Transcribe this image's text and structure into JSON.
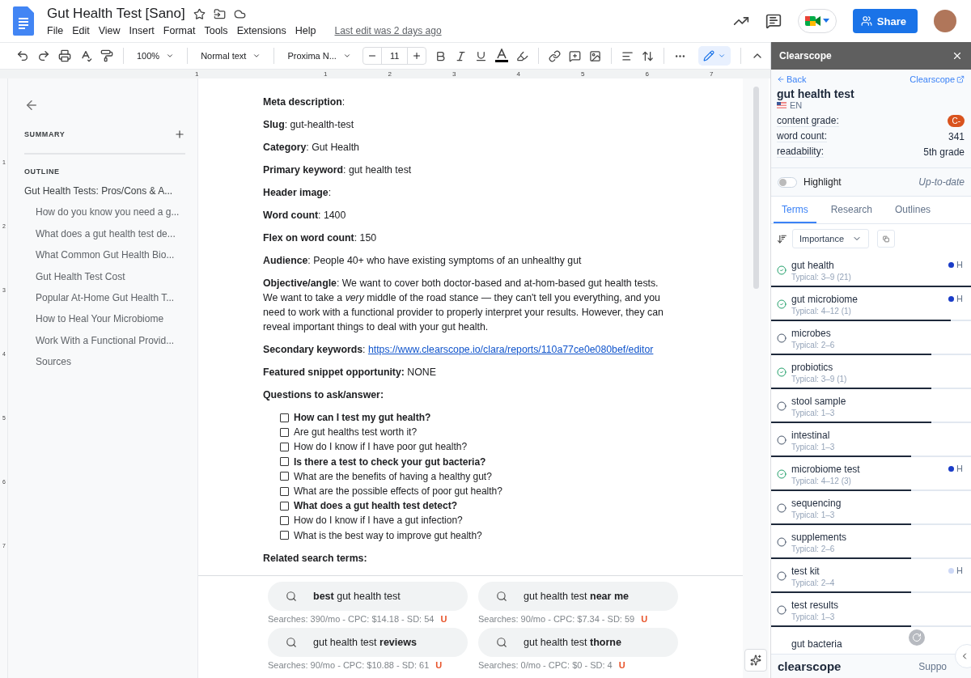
{
  "doc": {
    "title": "Gut Health Test [Sano]",
    "menu": [
      "File",
      "Edit",
      "View",
      "Insert",
      "Format",
      "Tools",
      "Extensions",
      "Help"
    ],
    "last_edit": "Last edit was 2 days ago"
  },
  "share": {
    "label": "Share"
  },
  "toolbar": {
    "zoom": "100%",
    "style": "Normal text",
    "font": "Proxima N...",
    "font_size": "11"
  },
  "ruler": [
    "1",
    "1",
    "2",
    "3",
    "4",
    "5",
    "6",
    "7"
  ],
  "vruler": [
    "1",
    "2",
    "3",
    "4",
    "5",
    "6",
    "7"
  ],
  "outline": {
    "summary_label": "SUMMARY",
    "outline_label": "OUTLINE",
    "items": [
      {
        "text": "Gut Health Tests: Pros/Cons & A...",
        "children": [
          {
            "text": "How do you know you need a g..."
          },
          {
            "text": "What does a gut health test de..."
          },
          {
            "text": "What Common Gut Health Bio..."
          },
          {
            "text": "Gut Health Test Cost"
          },
          {
            "text": "Popular At-Home Gut Health T..."
          },
          {
            "text": "How to Heal Your Microbiome"
          },
          {
            "text": "Work With a Functional Provid..."
          },
          {
            "text": "Sources"
          }
        ]
      }
    ]
  },
  "body": [
    {
      "kind": "para",
      "text": "**Meta description**:"
    },
    {
      "kind": "para",
      "text": "**Slug**: gut-health-test"
    },
    {
      "kind": "para",
      "text": "**Category**: Gut Health"
    },
    {
      "kind": "para",
      "text": "**Primary keyword**: gut health test"
    },
    {
      "kind": "para",
      "text": "**Header image**:"
    },
    {
      "kind": "para",
      "text": "**Word count**: 1400"
    },
    {
      "kind": "para",
      "text": "**Flex on word count**: 150"
    },
    {
      "kind": "para",
      "text": "**Audience**: People 40+ who have existing symptoms of an unhealthy gut"
    },
    {
      "kind": "para",
      "text": "**Objective/angle**: We want to cover both doctor-based and at-hom-based gut health tests. We want to take a *very* middle of the road stance — they can't tell you everything, and you need to work with a functional provider to properly interpret your results. However, they can reveal important things to deal with your gut health."
    },
    {
      "kind": "link",
      "text": "**Secondary keywords**:",
      "link": "https://www.clearscope.io/clara/reports/110a77ce0e080bef/editor"
    },
    {
      "kind": "para",
      "text": "**Featured snippet opportunity:** NONE"
    },
    {
      "kind": "heading",
      "text": "Questions to ask/answer:"
    },
    {
      "kind": "checklist",
      "items": [
        {
          "text": "How can I test my gut health?",
          "bold": true,
          "checked": false
        },
        {
          "text": "Are gut healths test worth it?",
          "bold": false,
          "checked": false
        },
        {
          "text": "How do I know if I have poor gut health?",
          "bold": false,
          "checked": false
        },
        {
          "text": "Is there a test to check your gut bacteria?",
          "bold": true,
          "checked": false
        },
        {
          "text": "What are the benefits of having a healthy gut?",
          "bold": false,
          "checked": false
        },
        {
          "text": "What are the possible effects of poor gut health?",
          "bold": false,
          "checked": false
        },
        {
          "text": "What does a gut health test detect?",
          "bold": true,
          "checked": false
        },
        {
          "text": "How do I know if I have a gut infection?",
          "bold": false,
          "checked": false
        },
        {
          "text": "What is the best way to improve gut health?",
          "bold": false,
          "checked": false
        }
      ]
    },
    {
      "kind": "heading",
      "text": "Related search terms:"
    }
  ],
  "related": [
    {
      "query": "**best** gut health test",
      "stats": "Searches: 390/mo - CPC: $14.18 - SD: 54",
      "mark": "U"
    },
    {
      "query": "gut health test **near me**",
      "stats": "Searches: 90/mo - CPC: $7.34 - SD: 59",
      "mark": "U"
    },
    {
      "query": "gut health test **reviews**",
      "stats": "Searches: 90/mo - CPC: $10.88 - SD: 61",
      "mark": "U"
    },
    {
      "query": "gut health test **thorne**",
      "stats": "Searches: 0/mo - CPC: $0 - SD: 4",
      "mark": "U"
    }
  ],
  "panel": {
    "title": "Clearscope",
    "back": "Back",
    "external": "Clearscope",
    "query": "gut health test",
    "language": "EN",
    "stats": [
      {
        "label": "content grade:",
        "value": "C-",
        "kind": "badge"
      },
      {
        "label": "word count:",
        "value": "341",
        "kind": "text"
      },
      {
        "label": "readability:",
        "value": "5th grade",
        "kind": "text"
      }
    ],
    "highlight": {
      "label": "Highlight",
      "on": false
    },
    "status": "Up-to-date",
    "tabs": [
      {
        "label": "Terms",
        "selected": true
      },
      {
        "label": "Research",
        "selected": false
      },
      {
        "label": "Outlines",
        "selected": false
      }
    ],
    "sort": "Importance",
    "terms": [
      {
        "term": "gut health",
        "typical": "Typical: 3–9 (21)",
        "covered": true,
        "level": 1.0,
        "priority": {
          "label": "H",
          "color": "#1a3cc8"
        }
      },
      {
        "term": "gut microbiome",
        "typical": "Typical: 4–12 (1)",
        "covered": true,
        "level": 0.9,
        "priority": {
          "label": "H",
          "color": "#1a3cc8"
        }
      },
      {
        "term": "microbes",
        "typical": "Typical: 2–6",
        "covered": false,
        "level": 0.8
      },
      {
        "term": "probiotics",
        "typical": "Typical: 3–9 (1)",
        "covered": true,
        "level": 0.8
      },
      {
        "term": "stool sample",
        "typical": "Typical: 1–3",
        "covered": false,
        "level": 0.8
      },
      {
        "term": "intestinal",
        "typical": "Typical: 1–3",
        "covered": false,
        "level": 0.7
      },
      {
        "term": "microbiome test",
        "typical": "Typical: 4–12 (3)",
        "covered": true,
        "level": 0.7,
        "priority": {
          "label": "H",
          "color": "#1a3cc8"
        }
      },
      {
        "term": "sequencing",
        "typical": "Typical: 1–3",
        "covered": false,
        "level": 0.7
      },
      {
        "term": "supplements",
        "typical": "Typical: 2–6",
        "covered": false,
        "level": 0.7
      },
      {
        "term": "test kit",
        "typical": "Typical: 2–4",
        "covered": false,
        "level": 0.7,
        "priority": {
          "label": "H",
          "color": "#cdd8f6"
        }
      },
      {
        "term": "test results",
        "typical": "Typical: 1–3",
        "covered": false,
        "level": 0.7
      },
      {
        "term": "gut bacteria"
      }
    ],
    "footer": {
      "brand": "clearscope",
      "link": "Suppo"
    }
  }
}
